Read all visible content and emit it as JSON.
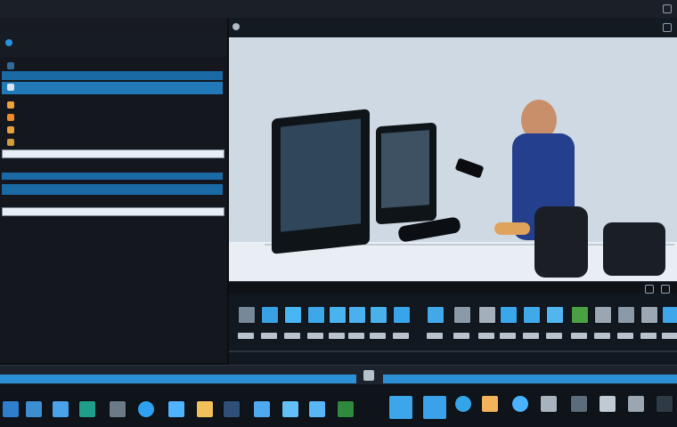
{
  "app": {
    "window_title": "",
    "viewer_title": ""
  },
  "topbar": {
    "items": [
      "",
      "",
      "",
      "",
      ""
    ]
  },
  "left_panel": {
    "rows": [
      {
        "label": ""
      },
      {
        "label": ""
      },
      {
        "label": ""
      },
      {
        "label": ""
      },
      {
        "label": ""
      },
      {
        "label": ""
      },
      {
        "label": ""
      }
    ],
    "fields": [
      "",
      "",
      ""
    ]
  },
  "viewer": {
    "status": ""
  },
  "filmstrip": {
    "labels": [
      "",
      "",
      ""
    ]
  },
  "taskbar": {
    "labels": [
      "",
      ""
    ]
  },
  "colors": {
    "accent": "#1a6aa6",
    "selection": "#2179b8",
    "panel": "#14181e"
  }
}
